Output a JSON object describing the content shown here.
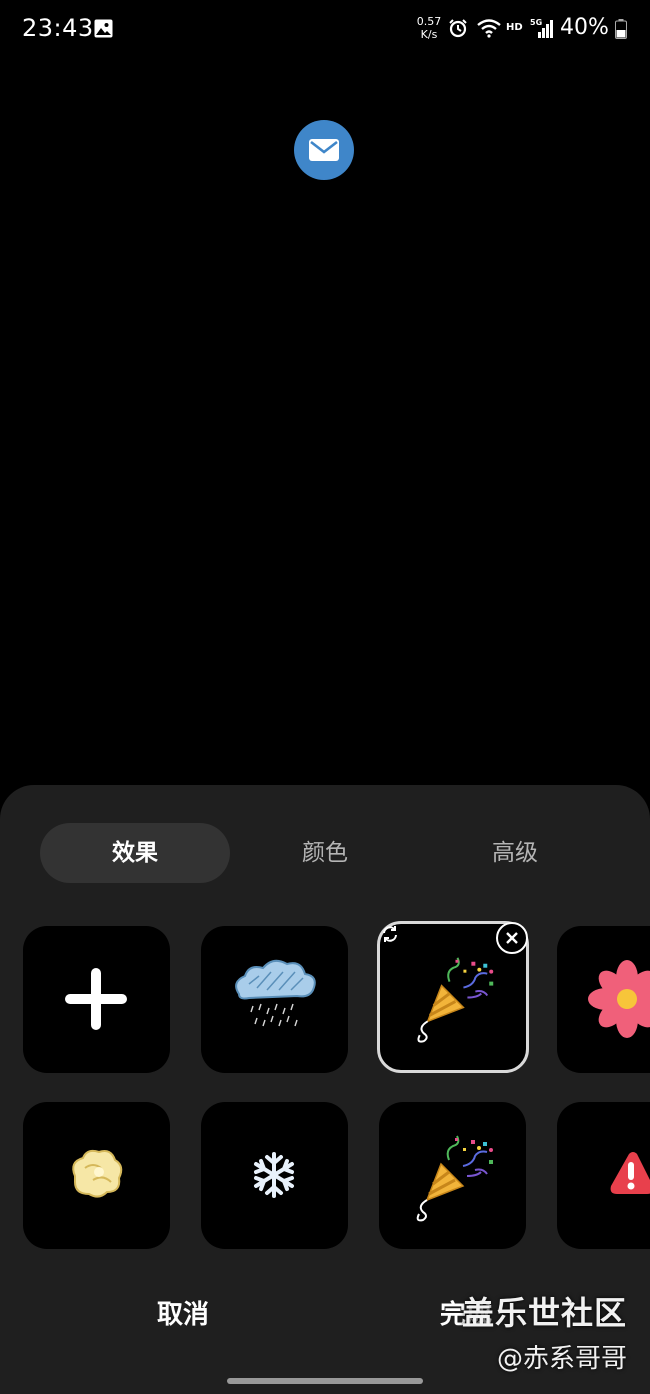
{
  "status_bar": {
    "time": "23:43",
    "net_speed_value": "0.57",
    "net_speed_unit": "K/s",
    "hd": "HD",
    "network": "5G",
    "battery": "40%"
  },
  "sheet": {
    "tabs": [
      {
        "label": "效果",
        "active": true
      },
      {
        "label": "颜色",
        "active": false
      },
      {
        "label": "高级",
        "active": false
      }
    ],
    "effects": [
      {
        "icon": "plus-icon"
      },
      {
        "icon": "rain-cloud-icon"
      },
      {
        "icon": "party-popper-icon",
        "selected": true
      },
      {
        "icon": "flower-icon"
      },
      {
        "icon": "popcorn-icon"
      },
      {
        "icon": "snowflake-icon"
      },
      {
        "icon": "party-popper-icon"
      },
      {
        "icon": "alert-icon"
      }
    ],
    "cancel_label": "取消",
    "done_label": "完成"
  },
  "watermark": {
    "title": "盖乐世社区",
    "author": "@赤系哥哥"
  },
  "colors": {
    "sheet_bg": "#1f1f1f",
    "tab_active_bg": "#333333",
    "mail_blue": "#3f86c9"
  }
}
